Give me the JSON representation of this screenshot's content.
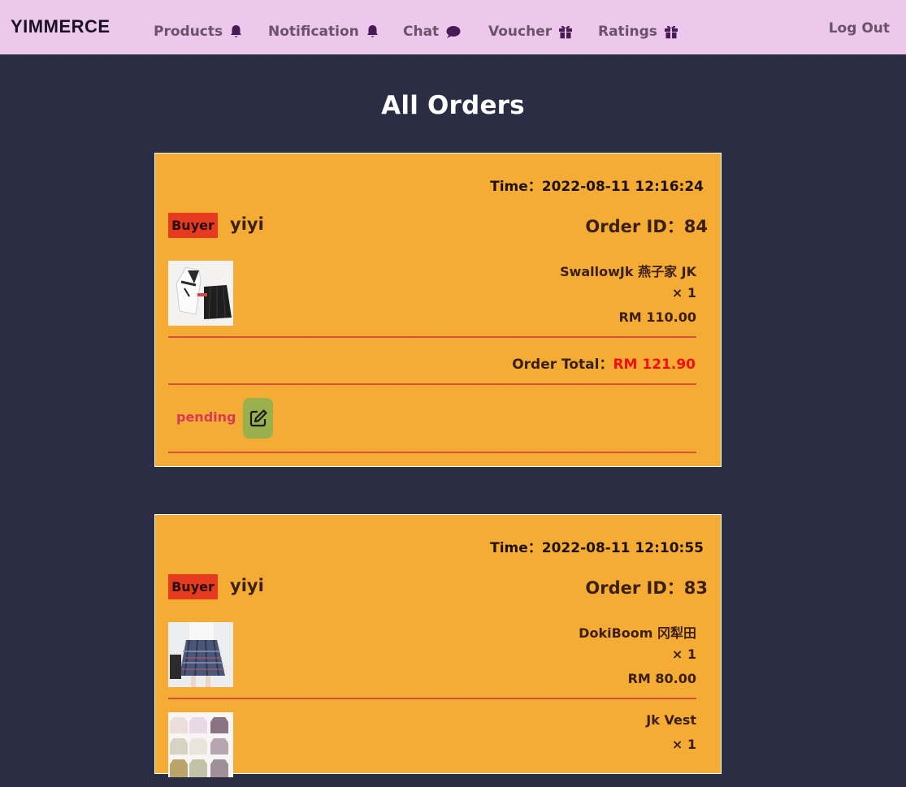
{
  "app": {
    "brand": "YIMMERCE",
    "nav": [
      {
        "label": "Products",
        "icon": "bell-icon"
      },
      {
        "label": "Notification",
        "icon": "bell-icon"
      },
      {
        "label": "Chat",
        "icon": "chat-bubble-icon"
      },
      {
        "label": "Voucher",
        "icon": "gift-icon"
      },
      {
        "label": "Ratings",
        "icon": "gift-icon"
      }
    ],
    "logout": "Log Out"
  },
  "page": {
    "title": "All Orders"
  },
  "orders": [
    {
      "time": "Time：2022-08-11 12:16:24",
      "badge": "Buyer",
      "buyer": "yiyi",
      "order_id": "Order ID：84",
      "items": [
        {
          "name": "SwallowJk 燕子家 JK",
          "qty": "× 1",
          "price": "RM 110.00",
          "thumb": "sailor-uniform-image"
        }
      ],
      "total_label": "Order Total：",
      "total_amount": "RM 121.90",
      "status": "pending"
    },
    {
      "time": "Time：2022-08-11 12:10:55",
      "badge": "Buyer",
      "buyer": "yiyi",
      "order_id": "Order ID：83",
      "items": [
        {
          "name": "DokiBoom 冈犁田",
          "qty": "× 1",
          "price": "RM 80.00",
          "thumb": "plaid-skirt-image"
        },
        {
          "name": "Jk Vest",
          "qty": "× 1",
          "price": "",
          "thumb": "vest-grid-image"
        }
      ]
    }
  ],
  "colors": {
    "navbar_bg": "#ebc8ec",
    "page_bg": "#2a2d44",
    "card_bg": "#f5ac34",
    "badge_bg": "#e63b21",
    "total_amount": "#f0100f",
    "status_text": "#d63a55",
    "edit_button_bg": "#99b04d",
    "icon_color": "#4a1a57"
  }
}
